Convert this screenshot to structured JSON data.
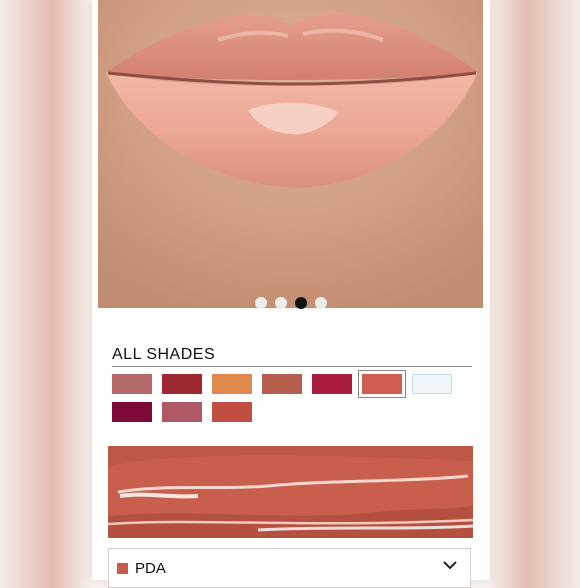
{
  "carousel": {
    "slide_count": 4,
    "active_index": 2
  },
  "shades": {
    "title": "ALL SHADES",
    "selected_index": 5,
    "swatches": [
      {
        "color": "#b76a6a"
      },
      {
        "color": "#9c2a32"
      },
      {
        "color": "#e08a4e"
      },
      {
        "color": "#b85e4e"
      },
      {
        "color": "#a91c3d"
      },
      {
        "color": "#d05d4f"
      },
      {
        "color": "#eef5fb"
      },
      {
        "color": "#7e0a3a"
      },
      {
        "color": "#b05966"
      },
      {
        "color": "#c24e42"
      }
    ]
  },
  "selected_shade": {
    "name": "PDA",
    "color": "#c85a4e"
  }
}
